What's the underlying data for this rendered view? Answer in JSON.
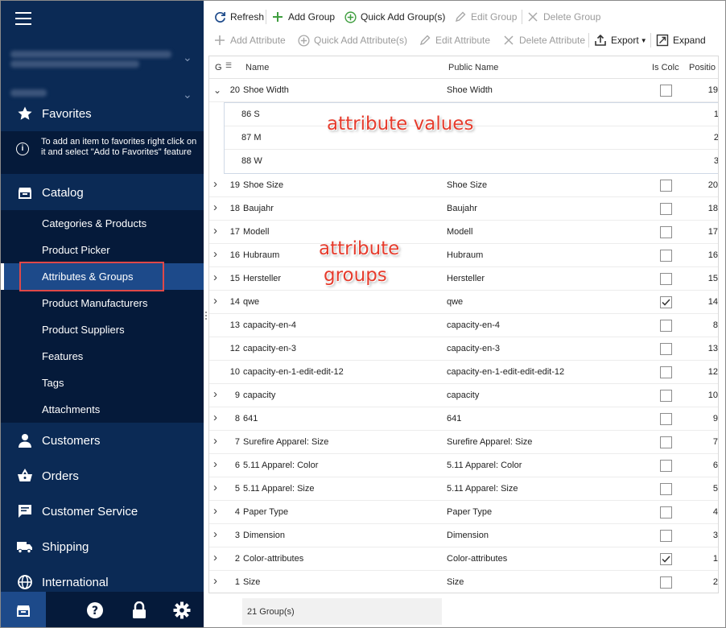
{
  "sidebar": {
    "favorites": "Favorites",
    "favorites_hint": "To add an item to favorites right click on it and select \"Add to Favorites\" feature",
    "catalog": "Catalog",
    "catalog_items": [
      "Categories & Products",
      "Product Picker",
      "Attributes & Groups",
      "Product Manufacturers",
      "Product Suppliers",
      "Features",
      "Tags",
      "Attachments"
    ],
    "active_item": "Attributes & Groups",
    "customers": "Customers",
    "orders": "Orders",
    "customer_service": "Customer Service",
    "shipping": "Shipping",
    "international": "International"
  },
  "toolbar1": {
    "refresh": "Refresh",
    "add_group": "Add Group",
    "quick_add_group": "Quick Add Group(s)",
    "edit_group": "Edit Group",
    "delete_group": "Delete Group"
  },
  "toolbar2": {
    "add_attribute": "Add Attribute",
    "quick_add_attribute": "Quick Add Attribute(s)",
    "edit_attribute": "Edit Attribute",
    "delete_attribute": "Delete Attribute",
    "export": "Export",
    "expand": "Expand"
  },
  "grid": {
    "columns": {
      "g": "G",
      "name": "Name",
      "public_name": "Public Name",
      "is_color": "Is Colc",
      "position": "Positio"
    },
    "expanded_group": {
      "id": "20",
      "name": "Shoe Width",
      "public_name": "Shoe Width",
      "is_color": false,
      "position": "19"
    },
    "values": [
      {
        "id": "86",
        "name": "S",
        "position": "1"
      },
      {
        "id": "87",
        "name": "M",
        "position": "2"
      },
      {
        "id": "88",
        "name": "W",
        "position": "3"
      }
    ],
    "groups": [
      {
        "id": "19",
        "name": "Shoe Size",
        "public_name": "Shoe Size",
        "is_color": false,
        "position": "20",
        "expandable": true
      },
      {
        "id": "18",
        "name": "Baujahr",
        "public_name": "Baujahr",
        "is_color": false,
        "position": "18",
        "expandable": true
      },
      {
        "id": "17",
        "name": "Modell",
        "public_name": "Modell",
        "is_color": false,
        "position": "17",
        "expandable": true
      },
      {
        "id": "16",
        "name": "Hubraum",
        "public_name": "Hubraum",
        "is_color": false,
        "position": "16",
        "expandable": true
      },
      {
        "id": "15",
        "name": "Hersteller",
        "public_name": "Hersteller",
        "is_color": false,
        "position": "15",
        "expandable": true
      },
      {
        "id": "14",
        "name": "qwe",
        "public_name": "qwe",
        "is_color": true,
        "position": "14",
        "expandable": true
      },
      {
        "id": "13",
        "name": "capacity-en-4",
        "public_name": "capacity-en-4",
        "is_color": false,
        "position": "8",
        "expandable": false
      },
      {
        "id": "12",
        "name": "capacity-en-3",
        "public_name": "capacity-en-3",
        "is_color": false,
        "position": "13",
        "expandable": false
      },
      {
        "id": "10",
        "name": "capacity-en-1-edit-edit-12",
        "public_name": "capacity-en-1-edit-edit-edit-12",
        "is_color": false,
        "position": "12",
        "expandable": false
      },
      {
        "id": "9",
        "name": "capacity",
        "public_name": "capacity",
        "is_color": false,
        "position": "10",
        "expandable": true
      },
      {
        "id": "8",
        "name": "641",
        "public_name": "641",
        "is_color": false,
        "position": "9",
        "expandable": true
      },
      {
        "id": "7",
        "name": "Surefire Apparel: Size",
        "public_name": "Surefire Apparel: Size",
        "is_color": false,
        "position": "7",
        "expandable": true
      },
      {
        "id": "6",
        "name": "5.11 Apparel: Color",
        "public_name": "5.11 Apparel: Color",
        "is_color": false,
        "position": "6",
        "expandable": true
      },
      {
        "id": "5",
        "name": "5.11 Apparel: Size",
        "public_name": "5.11 Apparel: Size",
        "is_color": false,
        "position": "5",
        "expandable": true
      },
      {
        "id": "4",
        "name": "Paper Type",
        "public_name": "Paper Type",
        "is_color": false,
        "position": "4",
        "expandable": true
      },
      {
        "id": "3",
        "name": "Dimension",
        "public_name": "Dimension",
        "is_color": false,
        "position": "3",
        "expandable": true
      },
      {
        "id": "2",
        "name": "Color-attributes",
        "public_name": "Color-attributes",
        "is_color": true,
        "position": "1",
        "expandable": true
      },
      {
        "id": "1",
        "name": "Size",
        "public_name": "Size",
        "is_color": false,
        "position": "2",
        "expandable": true
      }
    ],
    "footer": "21 Group(s)"
  },
  "annotations": {
    "values": "attribute values",
    "groups_line1": "attribute",
    "groups_line2": "groups"
  },
  "colors": {
    "sidebar_bg": "#0b2a55",
    "sidebar_sub_bg": "#051a3a",
    "active_bg": "#1d4a8a",
    "highlight": "#e04848",
    "annotation": "#e53b2c",
    "add_green": "#3f9e3f"
  },
  "icons": {
    "favorites": "star-icon",
    "info": "info-icon",
    "catalog": "catalog-icon",
    "customers": "person-icon",
    "orders": "basket-icon",
    "customer_service": "chat-icon",
    "shipping": "truck-icon",
    "international": "globe-icon"
  }
}
